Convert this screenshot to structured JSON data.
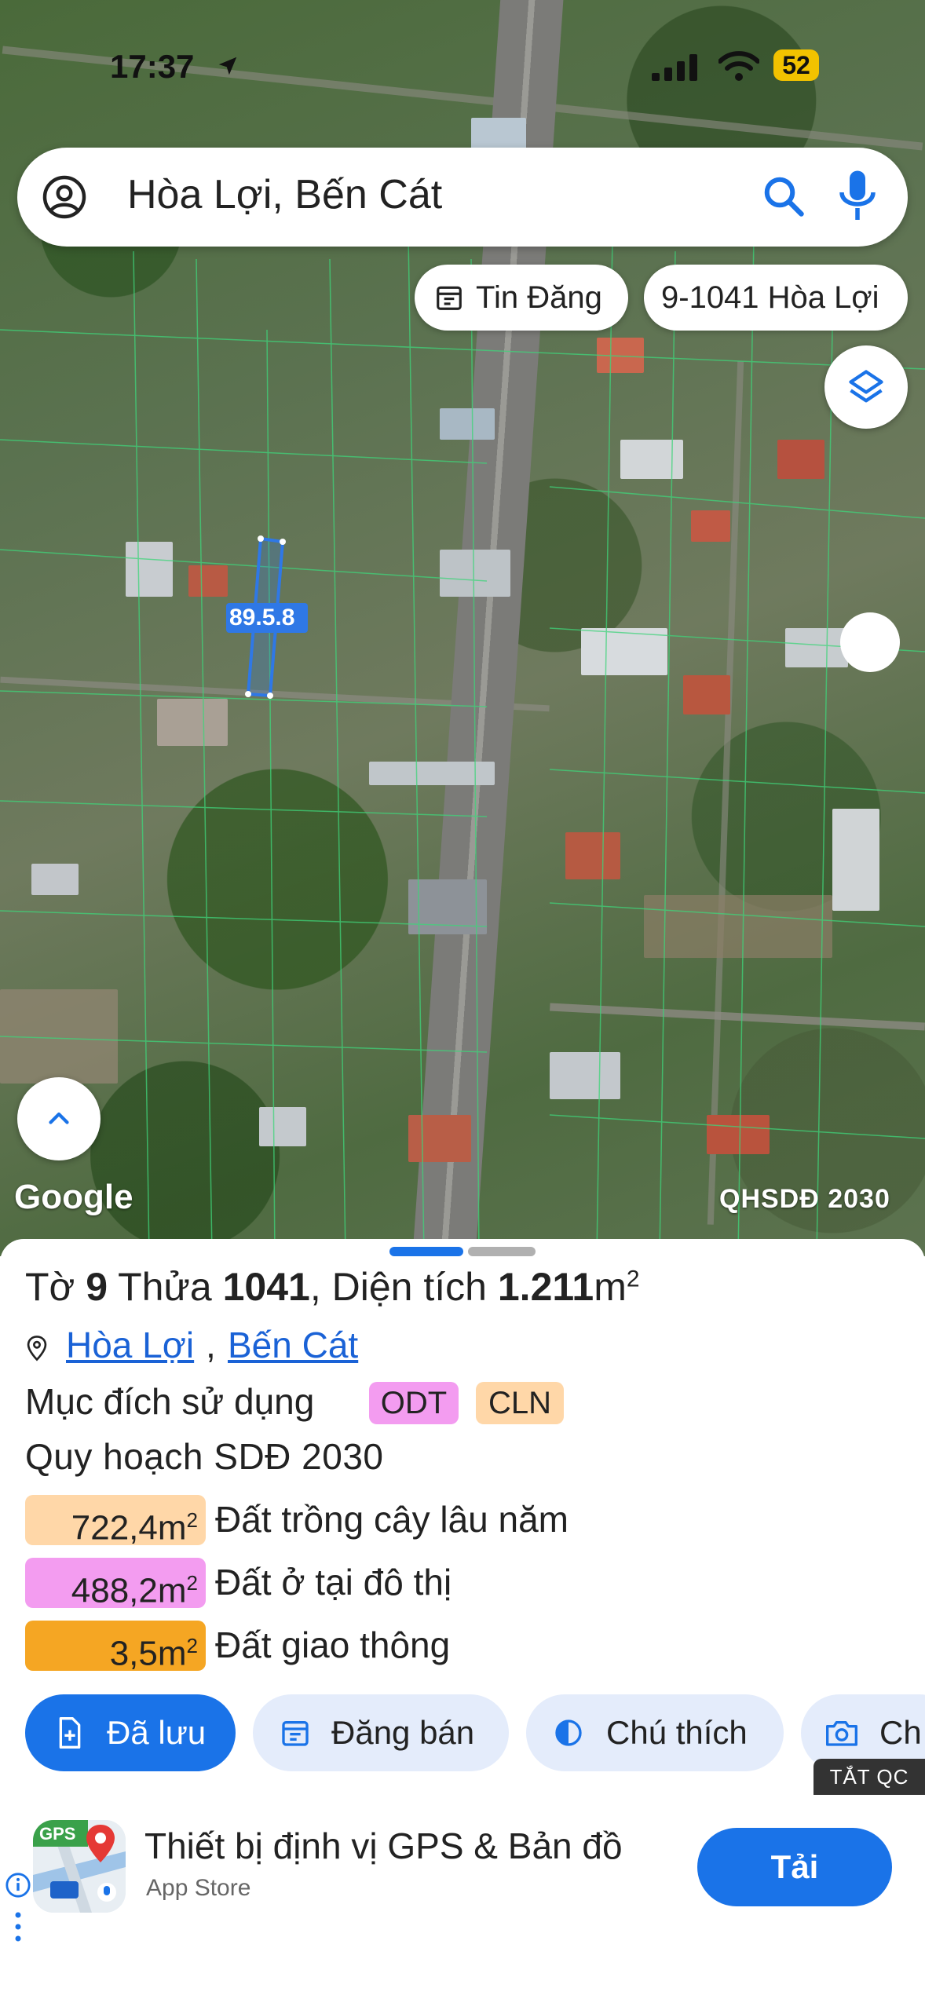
{
  "status_bar": {
    "time": "17:37",
    "battery": "52"
  },
  "search": {
    "query": "Hòa Lợi, Bến Cát"
  },
  "chips": {
    "news": "Tin Đăng",
    "parcel": "9-1041 Hòa Lợi"
  },
  "map": {
    "parcel_dimensions": "89.5",
    "parcel_dimensions_2": ".8",
    "logo": "Google",
    "plan_label": "QHSDĐ 2030"
  },
  "sheet": {
    "sheet_label": "Tờ",
    "sheet_no": "9",
    "plot_label": "Thửa",
    "plot_no": "1041",
    "area_label": "Diện tích",
    "area_value": "1.211",
    "area_unit": "m",
    "area_sup": "2",
    "ward": "Hòa Lợi",
    "district": "Bến Cát",
    "purpose_label": "Mục đích sử dụng",
    "tags": [
      "ODT",
      "CLN"
    ],
    "plan_title": "Quy hoạch SDĐ 2030",
    "land_use": [
      {
        "area": "722,4m",
        "sup": "2",
        "label": "Đất trồng cây lâu năm",
        "color": "#ffd7a8"
      },
      {
        "area": "488,2m",
        "sup": "2",
        "label": "Đất ở tại đô thị",
        "color": "#f39cf0"
      },
      {
        "area": "3,5m",
        "sup": "2",
        "label": "Đất giao thông",
        "color": "#f5a623"
      }
    ],
    "actions": {
      "saved": "Đã lưu",
      "sell": "Đăng bán",
      "legend": "Chú thích",
      "photo": "Ch"
    },
    "ad_toggle": "TẮT QC"
  },
  "ad": {
    "icon_text": "GPS",
    "title": "Thiết bị định vị GPS & Bản đồ",
    "store": "App Store",
    "cta": "Tải"
  },
  "colors": {
    "accent": "#1a73e8",
    "chip_bg": "#e4ecfb"
  }
}
